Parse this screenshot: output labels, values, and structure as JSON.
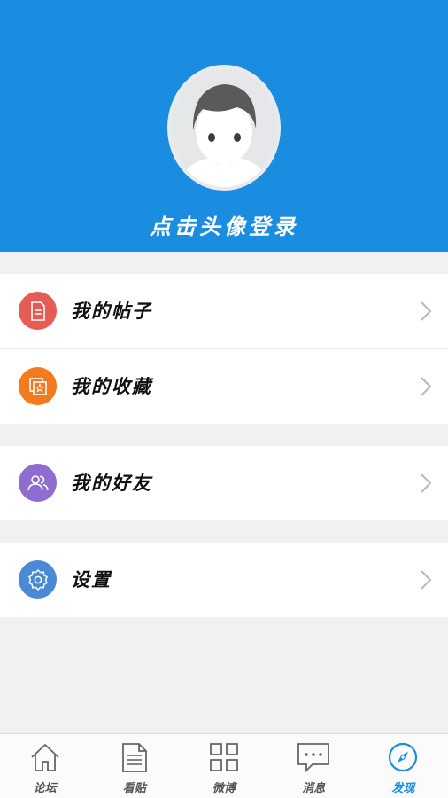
{
  "header": {
    "login_prompt": "点击头像登录",
    "background_color": "#1a8de0",
    "avatar_icon": "default-user-avatar"
  },
  "groups": [
    {
      "items": [
        {
          "label": "我的帖子",
          "icon": "document-icon",
          "icon_color": "#e65b53"
        },
        {
          "label": "我的收藏",
          "icon": "favorites-star-icon",
          "icon_color": "#f47a1f"
        }
      ]
    },
    {
      "items": [
        {
          "label": "我的好友",
          "icon": "friends-icon",
          "icon_color": "#8f6ccf"
        }
      ]
    },
    {
      "items": [
        {
          "label": "设置",
          "icon": "gear-icon",
          "icon_color": "#4a8ad4"
        }
      ]
    }
  ],
  "tabbar": {
    "active_index": 4,
    "active_color": "#1a8de0",
    "tabs": [
      {
        "label": "论坛",
        "icon": "home-icon"
      },
      {
        "label": "看贴",
        "icon": "post-document-icon"
      },
      {
        "label": "微博",
        "icon": "grid-icon"
      },
      {
        "label": "消息",
        "icon": "message-bubble-icon"
      },
      {
        "label": "发现",
        "icon": "compass-icon"
      }
    ]
  }
}
